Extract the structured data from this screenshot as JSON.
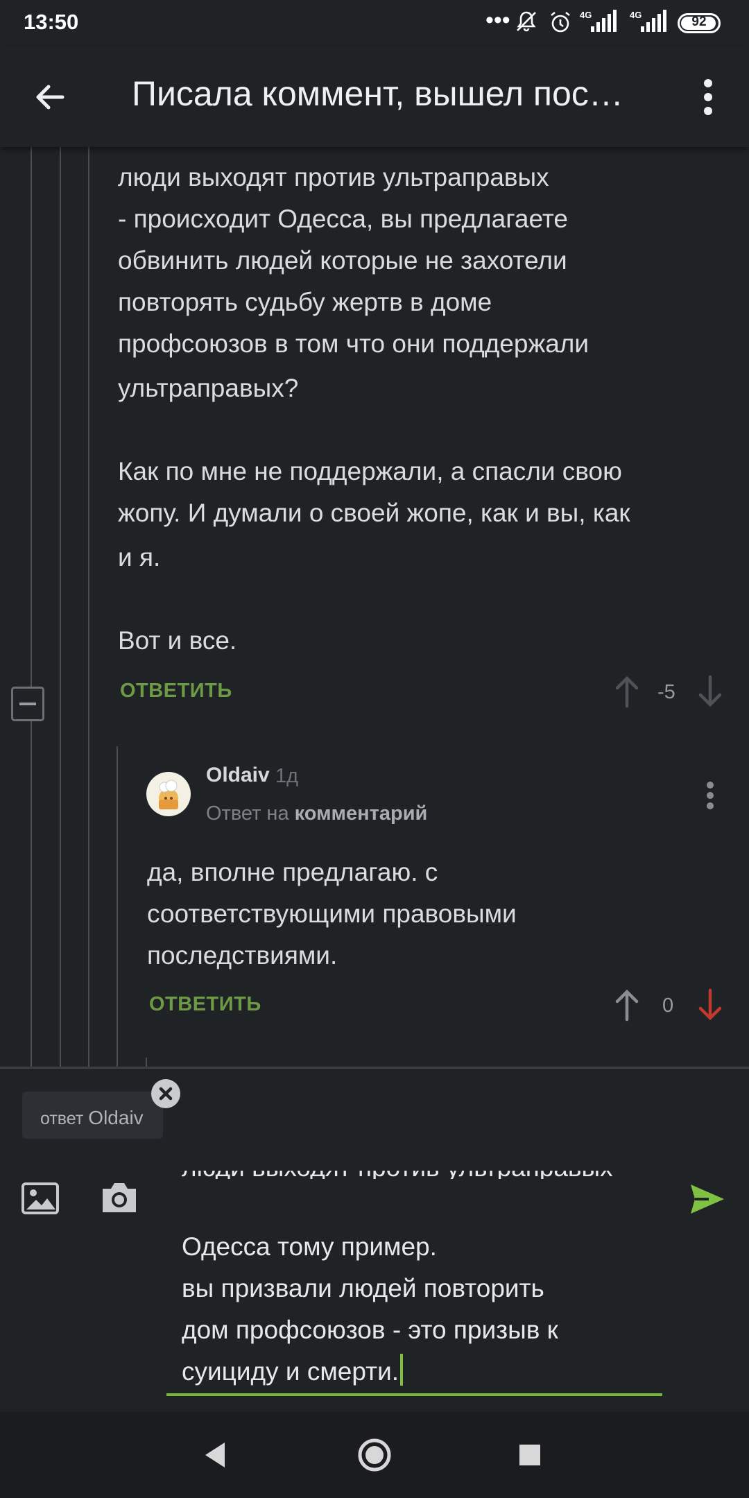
{
  "status": {
    "time": "13:50",
    "battery": "92",
    "net1": "4G",
    "net2": "4G"
  },
  "header": {
    "title": "Писала коммент, вышел пос…"
  },
  "parent_comment": {
    "lines": [
      "люди выходят против ультраправых",
      "- происходит Одесса, вы предлагаете",
      "обвинить людей которые не захотели",
      "повторять судьбу жертв в доме",
      "профсоюзов в том что они поддержали",
      "ультраправых?",
      "",
      "Как по мне не поддержали, а спасли свою",
      "жопу. И думали о своей жопе, как и вы, как",
      "и я.",
      "",
      "Вот и все."
    ],
    "reply_label": "ОТВЕТИТЬ",
    "score": "-5"
  },
  "reply_comment": {
    "author": "Oldaiv",
    "time_ago": "1д",
    "reply_prefix": "Ответ на",
    "reply_target": "комментарий",
    "lines": [
      "да, вполне предлагаю. с",
      "соответствующими правовыми",
      "последствиями."
    ],
    "reply_label": "ОТВЕТИТЬ",
    "score": "0"
  },
  "compose": {
    "reply_chip_prefix": "ответ",
    "reply_chip_name": "Oldaiv",
    "lines": [
      "Одесса тому пример.",
      "вы призвали людей повторить",
      "дом профсоюзов - это призыв к",
      "суициду и смерти."
    ]
  },
  "colors": {
    "background": "#202326",
    "accent_green": "#6d9a45",
    "downvote_red": "#c0392b",
    "send_green": "#7fc143"
  }
}
